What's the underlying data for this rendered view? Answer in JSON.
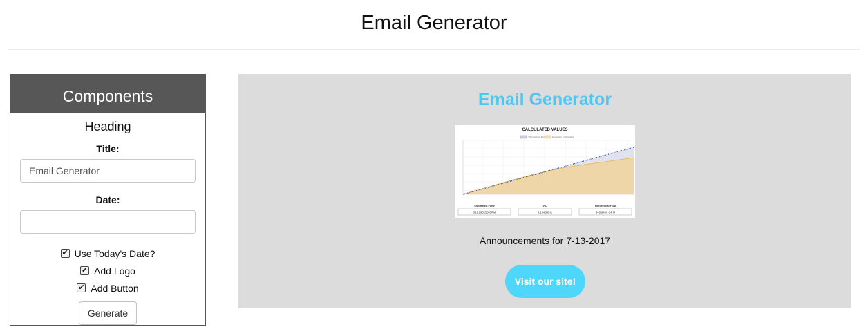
{
  "page": {
    "title": "Email Generator"
  },
  "components": {
    "header": "Components",
    "section": "Heading",
    "title_label": "Title:",
    "title_value": "Email Generator",
    "date_label": "Date:",
    "date_value": "",
    "options": [
      {
        "label": "Use Today's Date?",
        "checked": true
      },
      {
        "label": "Add Logo",
        "checked": true
      },
      {
        "label": "Add Button",
        "checked": true
      }
    ],
    "generate_label": "Generate"
  },
  "preview": {
    "title": "Email Generator",
    "logo_chart": {
      "title": "CALCULATED VALUES",
      "legend": [
        "Theoretical Flow",
        "Flowrate Estimated"
      ],
      "stats": [
        {
          "label": "Estimated Flow",
          "value": "331.993255 GPM"
        },
        {
          "label": "V/L",
          "value": "5.104545%"
        },
        {
          "label": "Theoretical Flow",
          "value": "348.9400 GPM"
        }
      ]
    },
    "announcement": "Announcements for 7-13-2017",
    "button_label": "Visit our site!"
  },
  "colors": {
    "panel_header": "#575757",
    "preview_bg": "#dcdcdc",
    "preview_title": "#4fc6ef",
    "button": "#4fd7fb"
  }
}
